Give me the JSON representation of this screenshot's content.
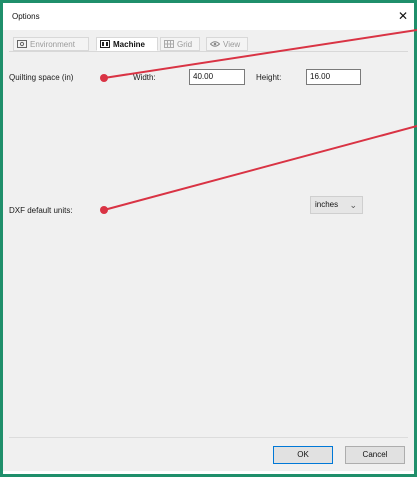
{
  "window": {
    "title": "Options",
    "close_glyph": "✕"
  },
  "tabs": [
    {
      "label": "Environment",
      "icon": "environment-icon",
      "active": false
    },
    {
      "label": "Machine",
      "icon": "machine-icon",
      "active": true
    },
    {
      "label": "Grid",
      "icon": "grid-icon",
      "active": false
    },
    {
      "label": "View",
      "icon": "eye-icon",
      "active": false
    }
  ],
  "machine": {
    "quilting_space_label": "Quilting space (in)",
    "width_label": "Width:",
    "width_value": "40.00",
    "height_label": "Height:",
    "height_value": "16.00",
    "dxf_units_label": "DXF default units:",
    "dxf_units_value": "inches"
  },
  "buttons": {
    "ok": "OK",
    "cancel": "Cancel"
  },
  "colors": {
    "frame_border": "#1f8f6b",
    "callout_line": "#d93344",
    "panel_bg": "#f0f0f0"
  }
}
